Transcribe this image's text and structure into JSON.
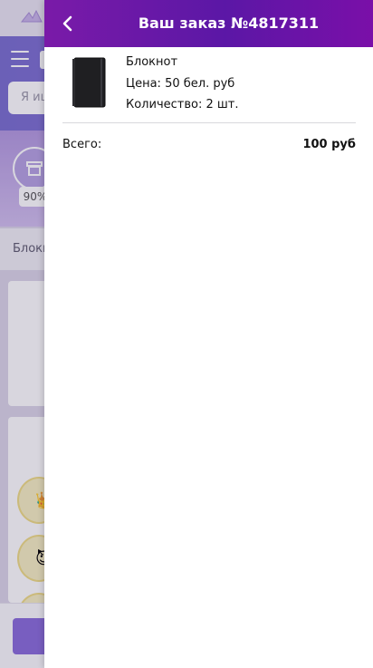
{
  "background": {
    "search_placeholder": "Я ищ",
    "progress_badge": "90%",
    "breadcrumb_text": "Блокн"
  },
  "drawer": {
    "title": "Ваш заказ №4817311",
    "back_icon": "chevron-left-icon",
    "header_colors": [
      "#7a1aa8",
      "#5b17a6"
    ]
  },
  "order": {
    "items": [
      {
        "name": "Блокнот",
        "price": "Цена: 50 бел. руб",
        "quantity": "Количество: 2 шт.",
        "image_icon": "notebook-image"
      }
    ],
    "total_label": "Всего:",
    "total_value": "100 руб"
  }
}
